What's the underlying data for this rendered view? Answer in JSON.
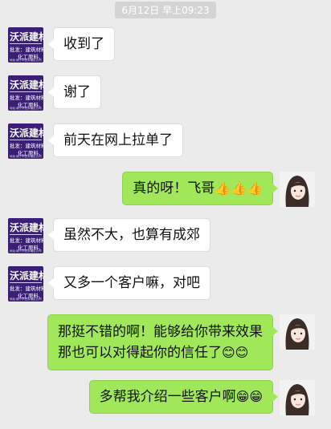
{
  "timestamp": "6月12日 早上09:23",
  "contact_avatar": {
    "title": "沃派建材",
    "line1": "批发：建筑材料、",
    "line2": "化工原料、",
    "line3": "地址:南宁市西乡塘区公司"
  },
  "messages": [
    {
      "side": "left",
      "text": "收到了"
    },
    {
      "side": "left",
      "text": "谢了"
    },
    {
      "side": "left",
      "text": "前天在网上拉单了"
    },
    {
      "side": "right",
      "text": "真的呀！飞哥",
      "emoji": "👍👍👍"
    },
    {
      "side": "left",
      "text": "虽然不大，也算有成郊"
    },
    {
      "side": "left",
      "text": "又多一个客户嘛，对吧"
    },
    {
      "side": "right",
      "line1": "那挺不错的啊！能够给你带来效果",
      "line2": "那也可以对得起你的信任了",
      "emoji": "😊😊"
    },
    {
      "side": "right",
      "text": "多帮我介绍一些客户啊",
      "emoji": "😁😁"
    }
  ],
  "colors": {
    "background": "#ebebeb",
    "bubble_sent": "#a0e75a",
    "bubble_received": "#ffffff",
    "avatar_left_bg": "#3a1e78"
  }
}
